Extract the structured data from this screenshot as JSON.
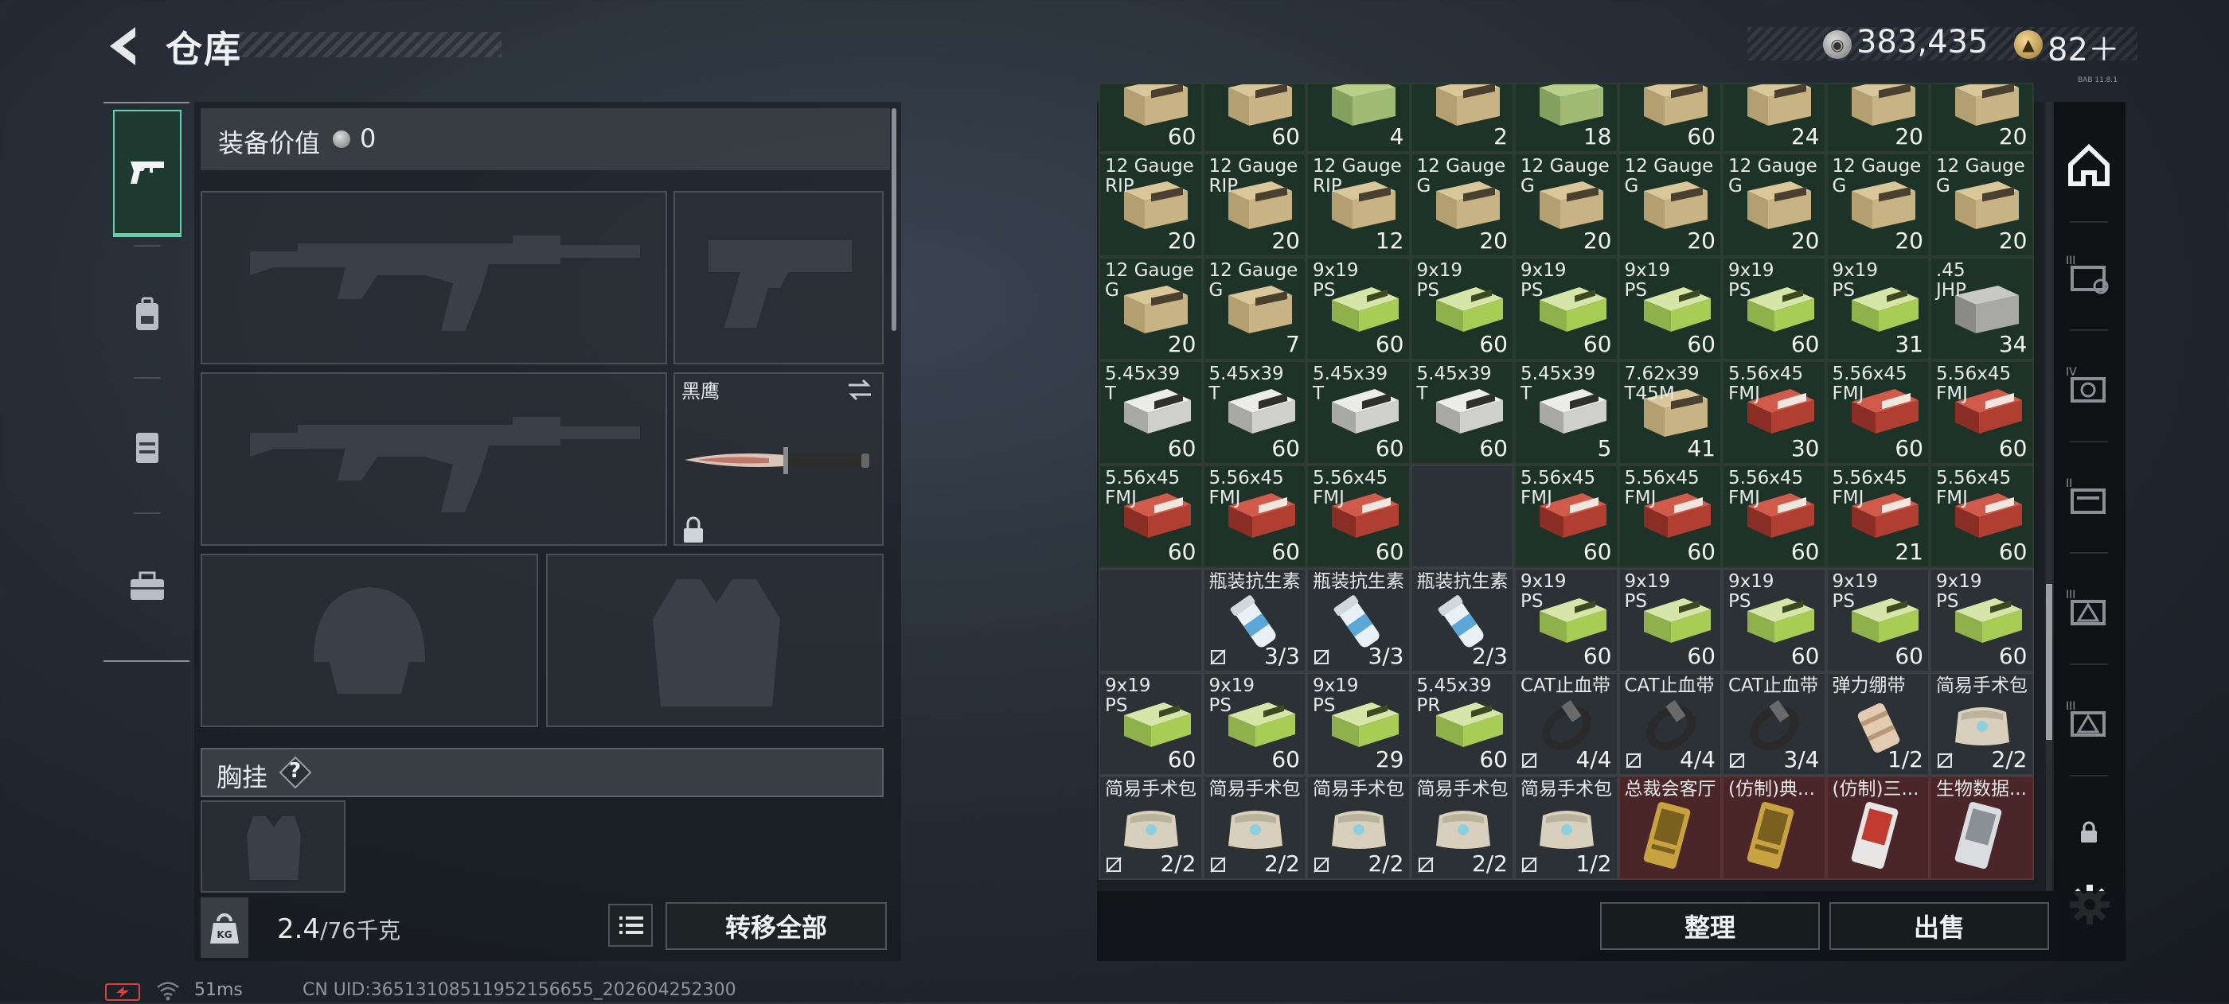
{
  "header": {
    "title": "仓库",
    "currency_main": "383,435",
    "currency_premium": "82＋",
    "tiny_label": "BAB 11.8.1"
  },
  "equipment": {
    "value_label": "装备价值",
    "value": "0",
    "knife_name": "黑鹰",
    "vest_label": "胸挂",
    "help_mark": "?",
    "weight": "2.4",
    "weight_max": "/76千克",
    "weight_icon_text": "KG",
    "transfer_label": "转移全部"
  },
  "status_bar": {
    "ping": "51ms",
    "uid": "CN UID:36513108511952156655_202604252300"
  },
  "buttons": {
    "sort": "整理",
    "sell": "出售"
  },
  "colors": {
    "accent_green": "#5fd3a7",
    "cell_green_bg": "#1e3328",
    "cell_gray_bg": "#2c3136",
    "cell_red_bg": "#4a2628"
  },
  "icons": {
    "left_tabs": [
      "pistol-icon",
      "backpack-icon",
      "rig-icon",
      "toolbox-icon"
    ],
    "right_tabs": [
      "house-icon",
      "stash-3-icon",
      "stash-4-icon",
      "stash-2-icon",
      "stash-3b-icon",
      "stash-3c-icon",
      "lock-icon",
      "settings-icon"
    ]
  },
  "inventory": {
    "rows": [
      [
        {
          "name": "",
          "sub": "",
          "count": "60",
          "bg": "green",
          "art": "box-tan"
        },
        {
          "name": "",
          "sub": "",
          "count": "60",
          "bg": "green",
          "art": "box-tan"
        },
        {
          "name": "",
          "sub": "",
          "count": "4",
          "bg": "green",
          "art": "box-green"
        },
        {
          "name": "",
          "sub": "",
          "count": "2",
          "bg": "green",
          "art": "box-tan"
        },
        {
          "name": "",
          "sub": "",
          "count": "18",
          "bg": "green",
          "art": "box-green"
        },
        {
          "name": "",
          "sub": "",
          "count": "60",
          "bg": "green",
          "art": "box-tan"
        },
        {
          "name": "",
          "sub": "",
          "count": "24",
          "bg": "green",
          "art": "box-tan"
        },
        {
          "name": "",
          "sub": "",
          "count": "20",
          "bg": "green",
          "art": "box-tan"
        },
        {
          "name": "",
          "sub": "",
          "count": "20",
          "bg": "green",
          "art": "box-tan"
        }
      ],
      [
        {
          "name": "12 Gauge",
          "sub": "RIP",
          "count": "20",
          "bg": "green",
          "art": "box-tan"
        },
        {
          "name": "12 Gauge",
          "sub": "RIP",
          "count": "20",
          "bg": "green",
          "art": "box-tan"
        },
        {
          "name": "12 Gauge",
          "sub": "RIP",
          "count": "12",
          "bg": "green",
          "art": "box-tan"
        },
        {
          "name": "12 Gauge",
          "sub": "G",
          "count": "20",
          "bg": "green",
          "art": "box-tan"
        },
        {
          "name": "12 Gauge",
          "sub": "G",
          "count": "20",
          "bg": "green",
          "art": "box-tan"
        },
        {
          "name": "12 Gauge",
          "sub": "G",
          "count": "20",
          "bg": "green",
          "art": "box-tan"
        },
        {
          "name": "12 Gauge",
          "sub": "G",
          "count": "20",
          "bg": "green",
          "art": "box-tan"
        },
        {
          "name": "12 Gauge",
          "sub": "G",
          "count": "20",
          "bg": "green",
          "art": "box-tan"
        },
        {
          "name": "12 Gauge",
          "sub": "G",
          "count": "20",
          "bg": "green",
          "art": "box-tan"
        }
      ],
      [
        {
          "name": "12 Gauge",
          "sub": "G",
          "count": "20",
          "bg": "green",
          "art": "box-tan"
        },
        {
          "name": "12 Gauge",
          "sub": "G",
          "count": "7",
          "bg": "green",
          "art": "box-tan"
        },
        {
          "name": "9x19",
          "sub": "PS",
          "count": "60",
          "bg": "green",
          "art": "box-lime"
        },
        {
          "name": "9x19",
          "sub": "PS",
          "count": "60",
          "bg": "green",
          "art": "box-lime"
        },
        {
          "name": "9x19",
          "sub": "PS",
          "count": "60",
          "bg": "green",
          "art": "box-lime"
        },
        {
          "name": "9x19",
          "sub": "PS",
          "count": "60",
          "bg": "green",
          "art": "box-lime"
        },
        {
          "name": "9x19",
          "sub": "PS",
          "count": "60",
          "bg": "green",
          "art": "box-lime"
        },
        {
          "name": "9x19",
          "sub": "PS",
          "count": "31",
          "bg": "green",
          "art": "box-lime"
        },
        {
          "name": ".45",
          "sub": "JHP",
          "count": "34",
          "bg": "green",
          "art": "box-gray"
        }
      ],
      [
        {
          "name": "5.45x39",
          "sub": "T",
          "count": "60",
          "bg": "green",
          "art": "box-white"
        },
        {
          "name": "5.45x39",
          "sub": "T",
          "count": "60",
          "bg": "green",
          "art": "box-white"
        },
        {
          "name": "5.45x39",
          "sub": "T",
          "count": "60",
          "bg": "green",
          "art": "box-white"
        },
        {
          "name": "5.45x39",
          "sub": "T",
          "count": "60",
          "bg": "green",
          "art": "box-white"
        },
        {
          "name": "5.45x39",
          "sub": "T",
          "count": "5",
          "bg": "green",
          "art": "box-white"
        },
        {
          "name": "7.62x39",
          "sub": "T45M",
          "count": "41",
          "bg": "green",
          "art": "box-tan"
        },
        {
          "name": "5.56x45",
          "sub": "FMJ",
          "count": "30",
          "bg": "green",
          "art": "box-red"
        },
        {
          "name": "5.56x45",
          "sub": "FMJ",
          "count": "60",
          "bg": "green",
          "art": "box-red"
        },
        {
          "name": "5.56x45",
          "sub": "FMJ",
          "count": "60",
          "bg": "green",
          "art": "box-red"
        }
      ],
      [
        {
          "name": "5.56x45",
          "sub": "FMJ",
          "count": "60",
          "bg": "green",
          "art": "box-red"
        },
        {
          "name": "5.56x45",
          "sub": "FMJ",
          "count": "60",
          "bg": "green",
          "art": "box-red"
        },
        {
          "name": "5.56x45",
          "sub": "FMJ",
          "count": "60",
          "bg": "green",
          "art": "box-red"
        },
        {
          "name": "",
          "sub": "",
          "count": "",
          "bg": "gray",
          "art": "none"
        },
        {
          "name": "5.56x45",
          "sub": "FMJ",
          "count": "60",
          "bg": "green",
          "art": "box-red"
        },
        {
          "name": "5.56x45",
          "sub": "FMJ",
          "count": "60",
          "bg": "green",
          "art": "box-red"
        },
        {
          "name": "5.56x45",
          "sub": "FMJ",
          "count": "60",
          "bg": "green",
          "art": "box-red"
        },
        {
          "name": "5.56x45",
          "sub": "FMJ",
          "count": "21",
          "bg": "green",
          "art": "box-red"
        },
        {
          "name": "5.56x45",
          "sub": "FMJ",
          "count": "60",
          "bg": "green",
          "art": "box-red"
        }
      ],
      [
        {
          "name": "",
          "sub": "",
          "count": "",
          "bg": "gray",
          "art": "none"
        },
        {
          "name": "瓶装抗生素",
          "sub": "",
          "count": "3/3",
          "bg": "gray",
          "art": "pill-bottle",
          "noaction": true
        },
        {
          "name": "瓶装抗生素",
          "sub": "",
          "count": "3/3",
          "bg": "gray",
          "art": "pill-bottle",
          "noaction": true
        },
        {
          "name": "瓶装抗生素",
          "sub": "",
          "count": "2/3",
          "bg": "gray",
          "art": "pill-bottle"
        },
        {
          "name": "9x19",
          "sub": "PS",
          "count": "60",
          "bg": "gray",
          "art": "box-lime"
        },
        {
          "name": "9x19",
          "sub": "PS",
          "count": "60",
          "bg": "gray",
          "art": "box-lime"
        },
        {
          "name": "9x19",
          "sub": "PS",
          "count": "60",
          "bg": "gray",
          "art": "box-lime"
        },
        {
          "name": "9x19",
          "sub": "PS",
          "count": "60",
          "bg": "gray",
          "art": "box-lime"
        },
        {
          "name": "9x19",
          "sub": "PS",
          "count": "60",
          "bg": "gray",
          "art": "box-lime"
        }
      ],
      [
        {
          "name": "9x19",
          "sub": "PS",
          "count": "60",
          "bg": "gray",
          "art": "box-lime"
        },
        {
          "name": "9x19",
          "sub": "PS",
          "count": "60",
          "bg": "gray",
          "art": "box-lime"
        },
        {
          "name": "9x19",
          "sub": "PS",
          "count": "29",
          "bg": "gray",
          "art": "box-lime"
        },
        {
          "name": "5.45x39",
          "sub": "PR",
          "count": "60",
          "bg": "gray",
          "art": "box-lime"
        },
        {
          "name": "CAT止血带",
          "sub": "",
          "count": "4/4",
          "bg": "gray",
          "art": "tourniquet",
          "noaction": true
        },
        {
          "name": "CAT止血带",
          "sub": "",
          "count": "4/4",
          "bg": "gray",
          "art": "tourniquet",
          "noaction": true
        },
        {
          "name": "CAT止血带",
          "sub": "",
          "count": "3/4",
          "bg": "gray",
          "art": "tourniquet",
          "noaction": true
        },
        {
          "name": "弹力绷带",
          "sub": "",
          "count": "1/2",
          "bg": "gray",
          "art": "bandage"
        },
        {
          "name": "简易手术包",
          "sub": "",
          "count": "2/2",
          "bg": "gray",
          "art": "surgkit",
          "noaction": true
        }
      ],
      [
        {
          "name": "简易手术包",
          "sub": "",
          "count": "2/2",
          "bg": "gray",
          "art": "surgkit",
          "noaction": true
        },
        {
          "name": "简易手术包",
          "sub": "",
          "count": "2/2",
          "bg": "gray",
          "art": "surgkit",
          "noaction": true
        },
        {
          "name": "简易手术包",
          "sub": "",
          "count": "2/2",
          "bg": "gray",
          "art": "surgkit",
          "noaction": true
        },
        {
          "name": "简易手术包",
          "sub": "",
          "count": "2/2",
          "bg": "gray",
          "art": "surgkit",
          "noaction": true
        },
        {
          "name": "简易手术包",
          "sub": "",
          "count": "1/2",
          "bg": "gray",
          "art": "surgkit",
          "noaction": true
        },
        {
          "name": "总裁会客厅",
          "sub": "",
          "count": "",
          "bg": "red",
          "art": "card-gold"
        },
        {
          "name": "(仿制)典...",
          "sub": "",
          "count": "",
          "bg": "red",
          "art": "card-gold"
        },
        {
          "name": "(仿制)三...",
          "sub": "",
          "count": "",
          "bg": "red",
          "art": "card-red"
        },
        {
          "name": "生物数据...",
          "sub": "",
          "count": "",
          "bg": "red",
          "art": "card-silver"
        }
      ]
    ]
  }
}
